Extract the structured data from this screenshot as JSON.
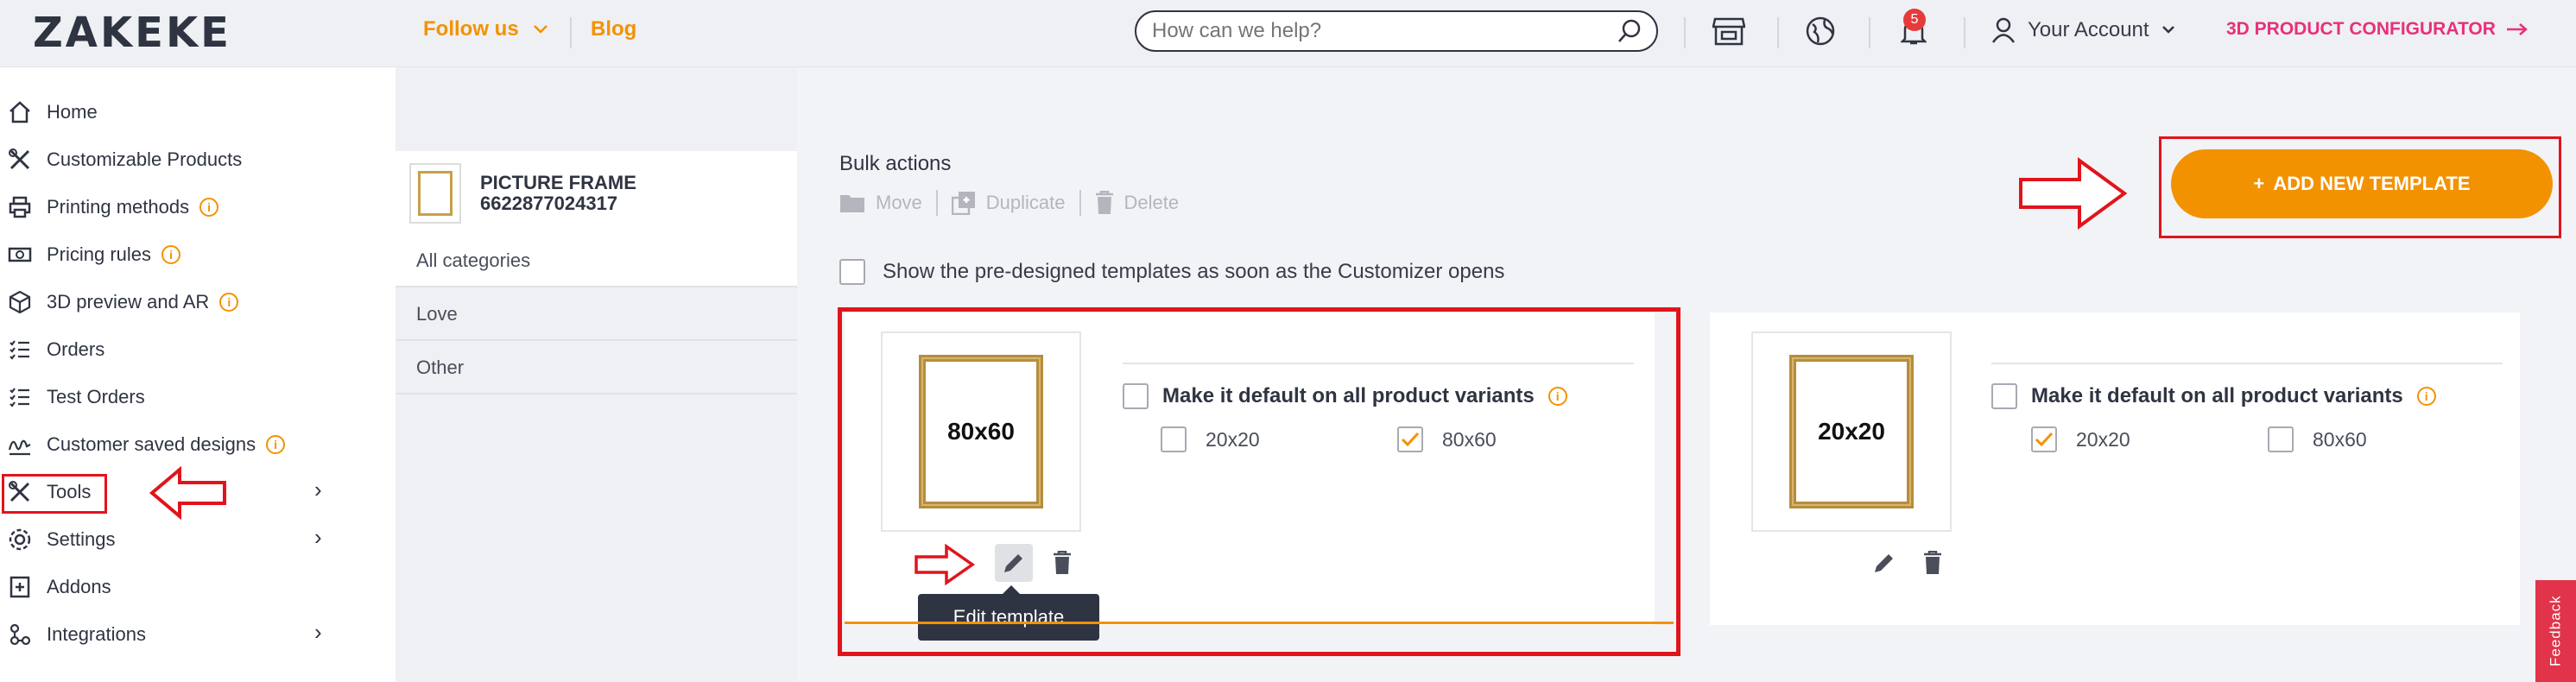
{
  "header": {
    "logo_text": "ZAKEKE",
    "follow_label": "Follow us",
    "blog_label": "Blog",
    "search_placeholder": "How can we help?",
    "notification_count": "5",
    "account_label": "Your Account",
    "configurator_label": "3D PRODUCT CONFIGURATOR"
  },
  "sidebar": {
    "items": [
      {
        "label": "Home",
        "icon": "home-icon"
      },
      {
        "label": "Customizable Products",
        "icon": "tools-icon"
      },
      {
        "label": "Printing methods",
        "icon": "printer-icon",
        "info": true
      },
      {
        "label": "Pricing rules",
        "icon": "money-icon",
        "info": true
      },
      {
        "label": "3D preview and AR",
        "icon": "cube-icon",
        "info": true
      },
      {
        "label": "Orders",
        "icon": "list-icon"
      },
      {
        "label": "Test Orders",
        "icon": "list-icon"
      },
      {
        "label": "Customer saved designs",
        "icon": "signature-icon",
        "info": true
      },
      {
        "label": "Tools",
        "icon": "tools-icon",
        "chevron": true
      },
      {
        "label": "Settings",
        "icon": "gear-icon",
        "chevron": true
      },
      {
        "label": "Addons",
        "icon": "addon-icon"
      },
      {
        "label": "Integrations",
        "icon": "integrations-icon",
        "chevron": true
      }
    ]
  },
  "product": {
    "name": "PICTURE FRAME",
    "id": "6622877024317"
  },
  "categories": [
    "All categories",
    "Love",
    "Other"
  ],
  "bulk": {
    "title": "Bulk actions",
    "move": "Move",
    "duplicate": "Duplicate",
    "delete": "Delete"
  },
  "show_predesigned": "Show the pre-designed templates as soon as the Customizer opens",
  "add_template_label": "ADD NEW TEMPLATE",
  "templates": [
    {
      "preview_text": "80x60",
      "default_label": "Make it default on all product variants",
      "variants": [
        {
          "label": "20x20",
          "checked": false
        },
        {
          "label": "80x60",
          "checked": true
        }
      ]
    },
    {
      "preview_text": "20x20",
      "default_label": "Make it default on all product variants",
      "variants": [
        {
          "label": "20x20",
          "checked": true
        },
        {
          "label": "80x60",
          "checked": false
        }
      ]
    }
  ],
  "tooltip": "Edit template",
  "feedback_label": "Feedback",
  "colors": {
    "accent": "#f39200",
    "highlight": "#e1141c",
    "configurator": "#e8307a"
  }
}
